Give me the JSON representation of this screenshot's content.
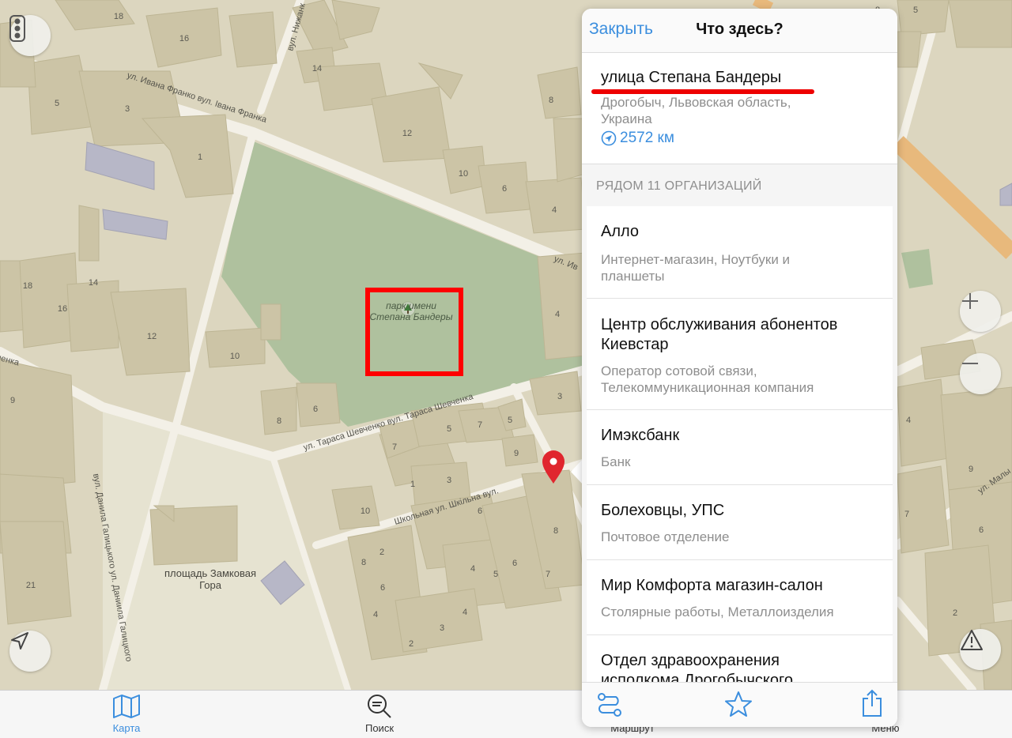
{
  "map": {
    "park_label": "парк имени Степана Бандеры",
    "square_label": "площадь Замковая Гора",
    "streets": {
      "franko": "ул. Ивана Франко вул. Івана Франка",
      "shevchenko": "ул. Тараса Шевченко вул. Тараса Шевченка",
      "school": "Школьная ул. Шкільна вул.",
      "galitsky": "вул. Данила Галицького ул. Даниила Галицкого",
      "nizhn": "вул. Нижанк",
      "iv_right": "ул. Ив",
      "chenko_left": "ченка",
      "maly": "ул. Малы"
    },
    "house_numbers": [
      "18",
      "16",
      "14",
      "5",
      "3",
      "1",
      "8",
      "12",
      "10",
      "6",
      "4",
      "18",
      "16",
      "14",
      "12",
      "10",
      "8",
      "6",
      "5",
      "7",
      "9",
      "1",
      "3",
      "10",
      "2",
      "8",
      "6",
      "4",
      "2",
      "3",
      "4",
      "5",
      "6",
      "7",
      "8",
      "9",
      "21",
      "4",
      "4",
      "3",
      "9",
      "7",
      "6",
      "2",
      "5"
    ]
  },
  "controls": {
    "traffic_icon": "traffic-light-icon",
    "locate_icon": "location-arrow-icon",
    "zoom_in_icon": "plus-icon",
    "zoom_out_icon": "minus-icon",
    "warning_icon": "warning-icon"
  },
  "panel": {
    "close_label": "Закрыть",
    "title": "Что здесь?",
    "street": "улица Степана Бандеры",
    "region": "Дрогобыч, Львовская область, Украина",
    "distance": "2572 км",
    "section_header": "РЯДОМ 11 ОРГАНИЗАЦИЙ",
    "items": [
      {
        "title": "Алло",
        "subtitle": "Интернет-магазин, Ноутбуки и планшеты"
      },
      {
        "title": "Центр обслуживания абонентов Киевстар",
        "subtitle": "Оператор сотовой связи, Телекоммуникационная компания"
      },
      {
        "title": "Имэксбанк",
        "subtitle": "Банк"
      },
      {
        "title": "Болеховцы, УПС",
        "subtitle": "Почтовое отделение"
      },
      {
        "title": "Мир Комфорта магазин-салон",
        "subtitle": "Столярные работы, Металлоизделия"
      },
      {
        "title": "Отдел здравоохранения исполкома Дрогобычского",
        "subtitle": ""
      }
    ]
  },
  "tabs": [
    {
      "label": "Карта",
      "icon": "map-icon",
      "color": "#3b8ede"
    },
    {
      "label": "Поиск",
      "icon": "search-icon",
      "color": "#333333"
    },
    {
      "label": "Маршрут",
      "icon": "route-icon",
      "color": "#333333"
    },
    {
      "label": "Меню",
      "icon": "menu-icon",
      "color": "#333333"
    }
  ],
  "colors": {
    "map_bg": "#dcd6bf",
    "building": "#ccc4a6",
    "park": "#afc19e",
    "road": "#f2efe6",
    "accent": "#3b8ede",
    "highlight": "#ff0000",
    "pin": "#e0262e"
  }
}
